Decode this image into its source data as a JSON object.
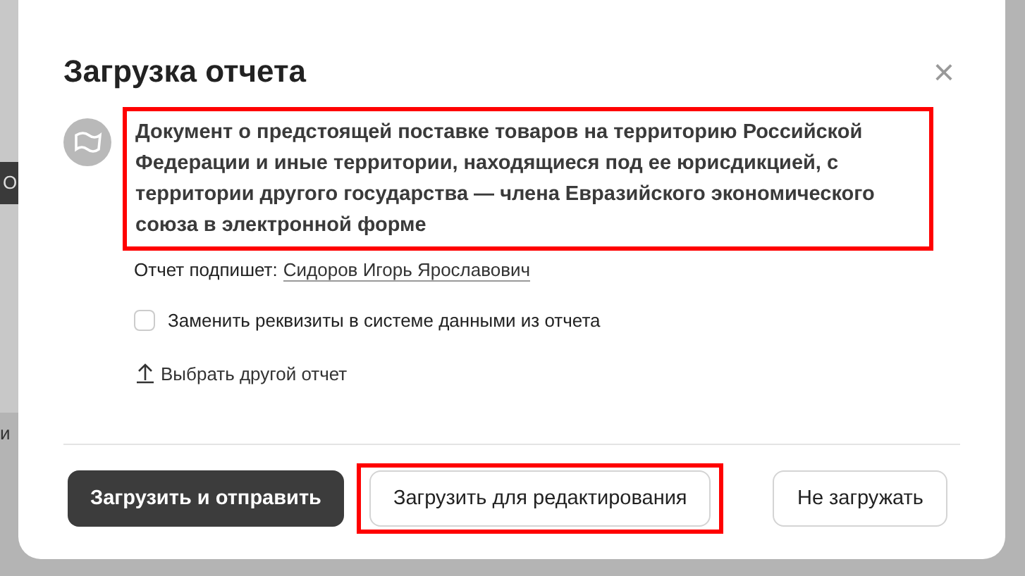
{
  "background_fragments": [
    {
      "text": "О",
      "kind": "dark"
    },
    {
      "text": "и",
      "kind": "light"
    }
  ],
  "dialog": {
    "title": "Загрузка отчета",
    "close": "×",
    "description": {
      "text": "Документ о предстоящей поставке товаров на территорию Российской Федерации и иные территории, находящиеся под ее юрисдикцией, с территории другого государства — члена Евразийского экономического союза в электронной форме",
      "highlighted": true
    },
    "signer_label": "Отчет подпишет:",
    "signer_name": "Сидоров Игорь Ярославович",
    "checkbox": {
      "label": "Заменить реквизиты в системе данными из отчета",
      "checked": false
    },
    "choose_other": "Выбрать другой отчет",
    "buttons": [
      {
        "label": "Загрузить и отправить",
        "kind": "primary",
        "highlighted": false
      },
      {
        "label": "Загрузить для редактирования",
        "kind": "secondary",
        "highlighted": true
      },
      {
        "label": "Не загружать",
        "kind": "secondary",
        "highlighted": false
      }
    ]
  }
}
